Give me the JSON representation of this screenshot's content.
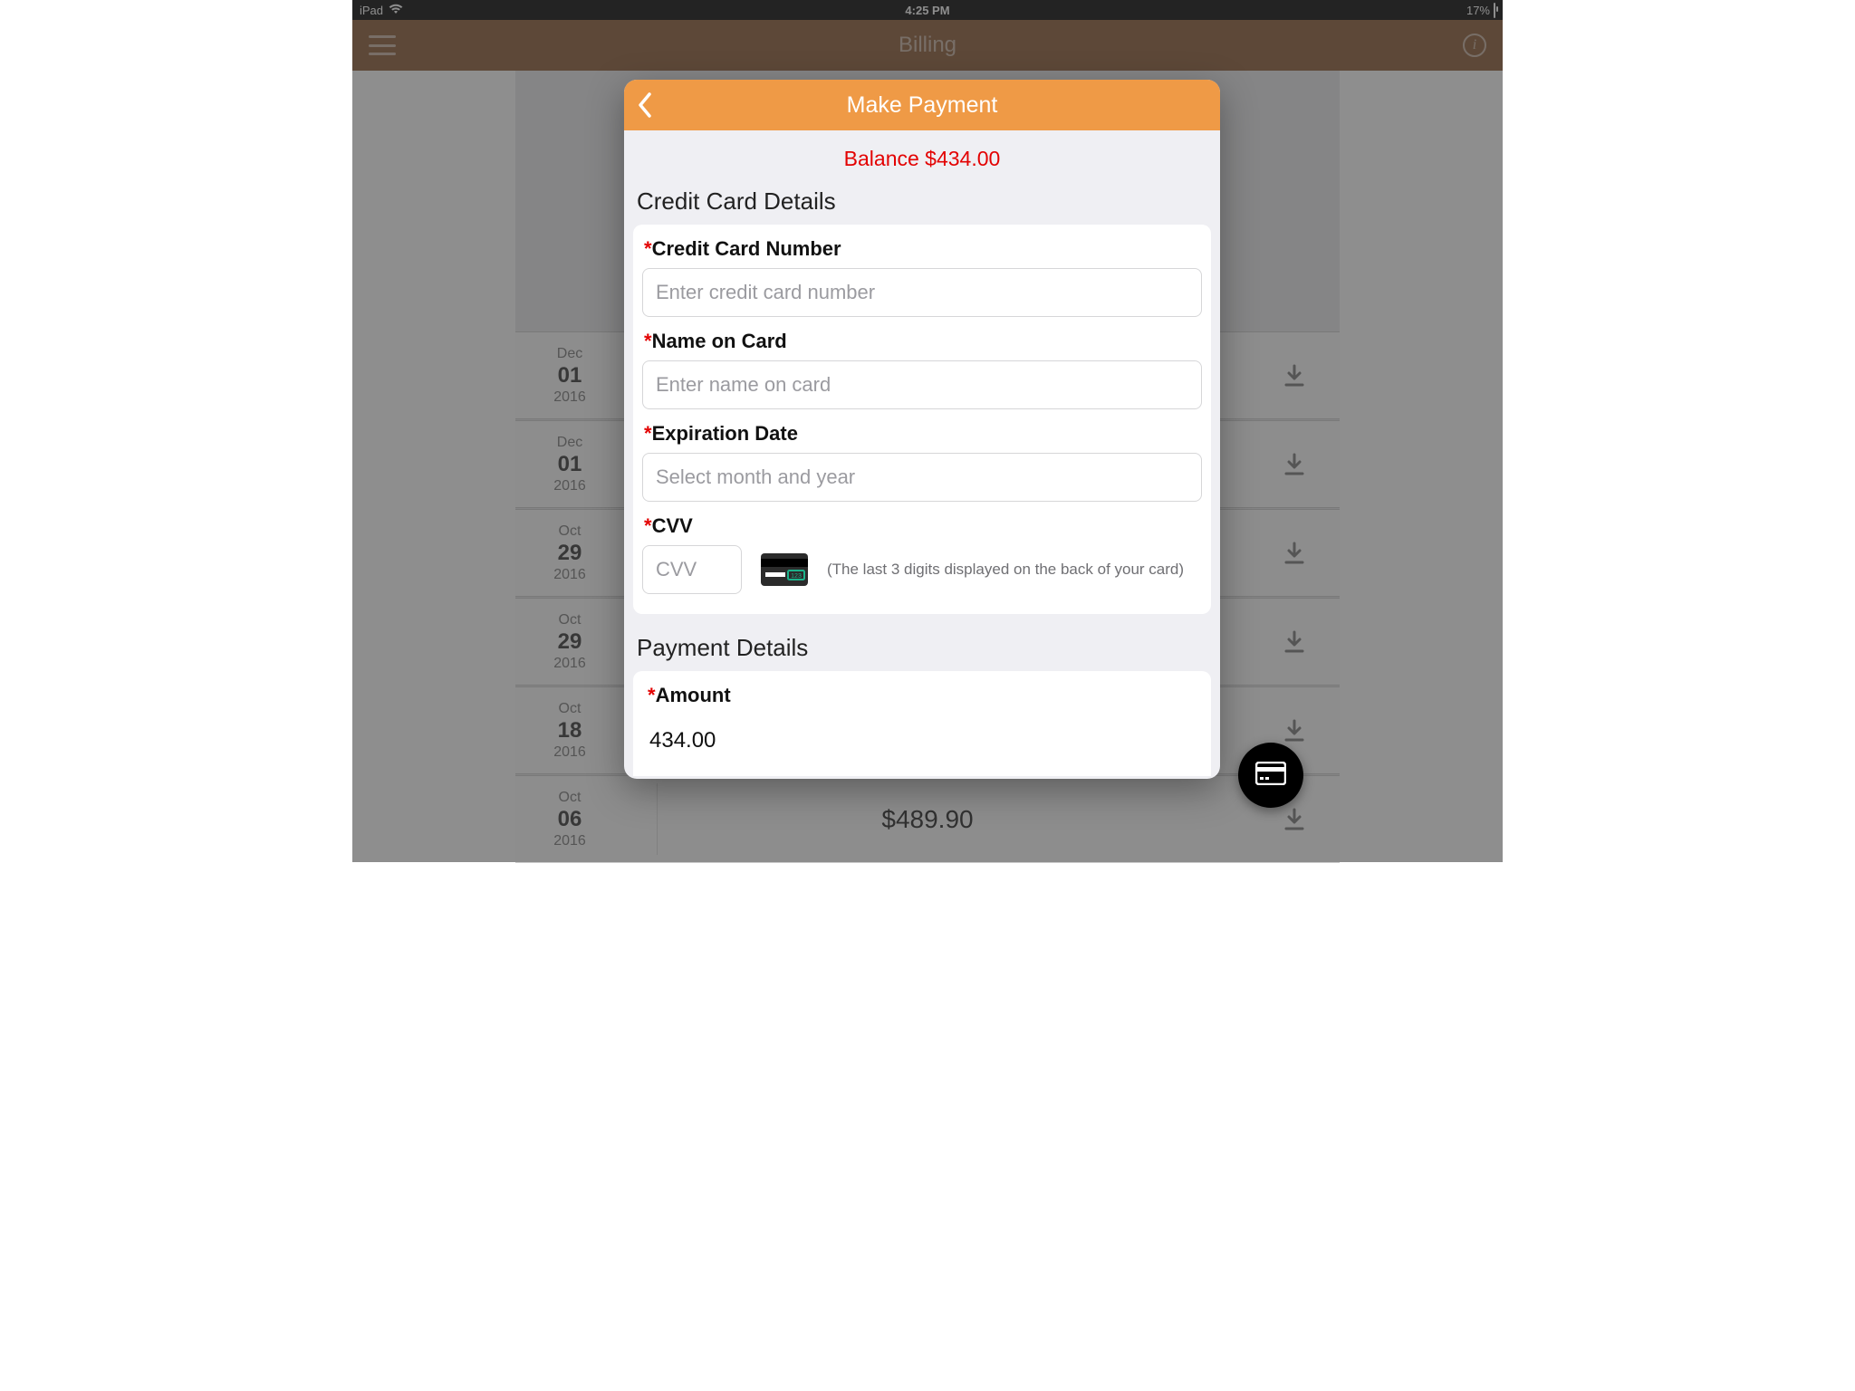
{
  "status": {
    "device": "iPad",
    "time": "4:25 PM",
    "battery": "17%"
  },
  "nav": {
    "title": "Billing"
  },
  "bills": [
    {
      "mon": "Dec",
      "day": "01",
      "yr": "2016",
      "amount": ""
    },
    {
      "mon": "Dec",
      "day": "01",
      "yr": "2016",
      "amount": ""
    },
    {
      "mon": "Oct",
      "day": "29",
      "yr": "2016",
      "amount": ""
    },
    {
      "mon": "Oct",
      "day": "29",
      "yr": "2016",
      "amount": ""
    },
    {
      "mon": "Oct",
      "day": "18",
      "yr": "2016",
      "amount": ""
    },
    {
      "mon": "Oct",
      "day": "06",
      "yr": "2016",
      "amount": "$489.90"
    }
  ],
  "modal": {
    "title": "Make Payment",
    "balance": "Balance $434.00",
    "sections": {
      "cc": "Credit Card Details",
      "payment": "Payment Details"
    },
    "fields": {
      "cc_number": {
        "label": "Credit Card Number",
        "placeholder": "Enter credit card number",
        "value": ""
      },
      "name": {
        "label": "Name on Card",
        "placeholder": "Enter name on card",
        "value": ""
      },
      "exp": {
        "label": "Expiration Date",
        "placeholder": "Select month and year",
        "value": ""
      },
      "cvv": {
        "label": "CVV",
        "placeholder": "CVV",
        "value": "",
        "hint": "(The last 3 digits displayed on the back of your card)"
      },
      "amount": {
        "label": "Amount",
        "value": "434.00"
      }
    },
    "required_mark": "*"
  }
}
